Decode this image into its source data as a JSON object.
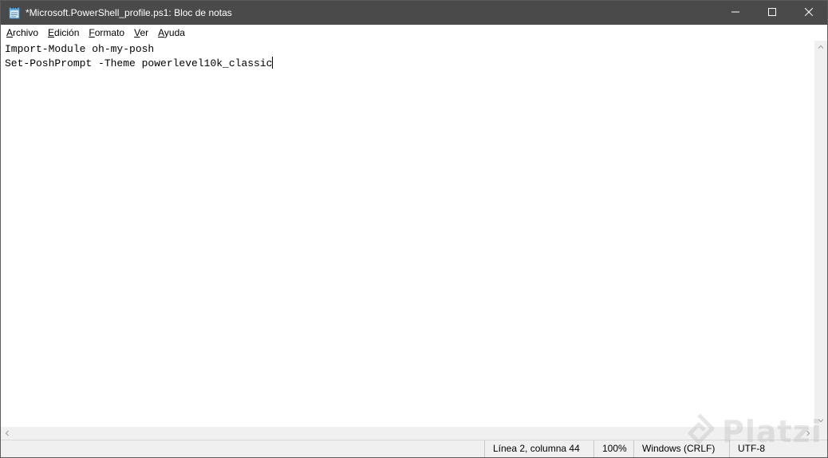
{
  "window": {
    "title": "*Microsoft.PowerShell_profile.ps1: Bloc de notas"
  },
  "icons": {
    "app": "notepad-icon",
    "minimize": "minimize-icon",
    "maximize": "maximize-icon",
    "close": "close-icon",
    "scroll_up": "chevron-up-icon",
    "scroll_down": "chevron-down-icon",
    "scroll_left": "chevron-left-icon",
    "scroll_right": "chevron-right-icon"
  },
  "menu": {
    "items": [
      {
        "label": "Archivo",
        "accesskey": "A",
        "rest": "rchivo"
      },
      {
        "label": "Edición",
        "accesskey": "E",
        "rest": "dición"
      },
      {
        "label": "Formato",
        "accesskey": "F",
        "rest": "ormato"
      },
      {
        "label": "Ver",
        "accesskey": "V",
        "rest": "er"
      },
      {
        "label": "Ayuda",
        "accesskey": "A",
        "rest": "yuda"
      }
    ]
  },
  "editor": {
    "lines": [
      "Import-Module oh-my-posh",
      "Set-PoshPrompt -Theme powerlevel10k_classic"
    ]
  },
  "status": {
    "position": "Línea 2, columna 44",
    "zoom": "100%",
    "line_ending": "Windows (CRLF)",
    "encoding": "UTF-8"
  },
  "watermark": {
    "text": "Platzi"
  },
  "colors": {
    "titlebar": "#4a4a4a",
    "statusbar": "#f0f0f0",
    "watermark": "#b9b9b9"
  }
}
